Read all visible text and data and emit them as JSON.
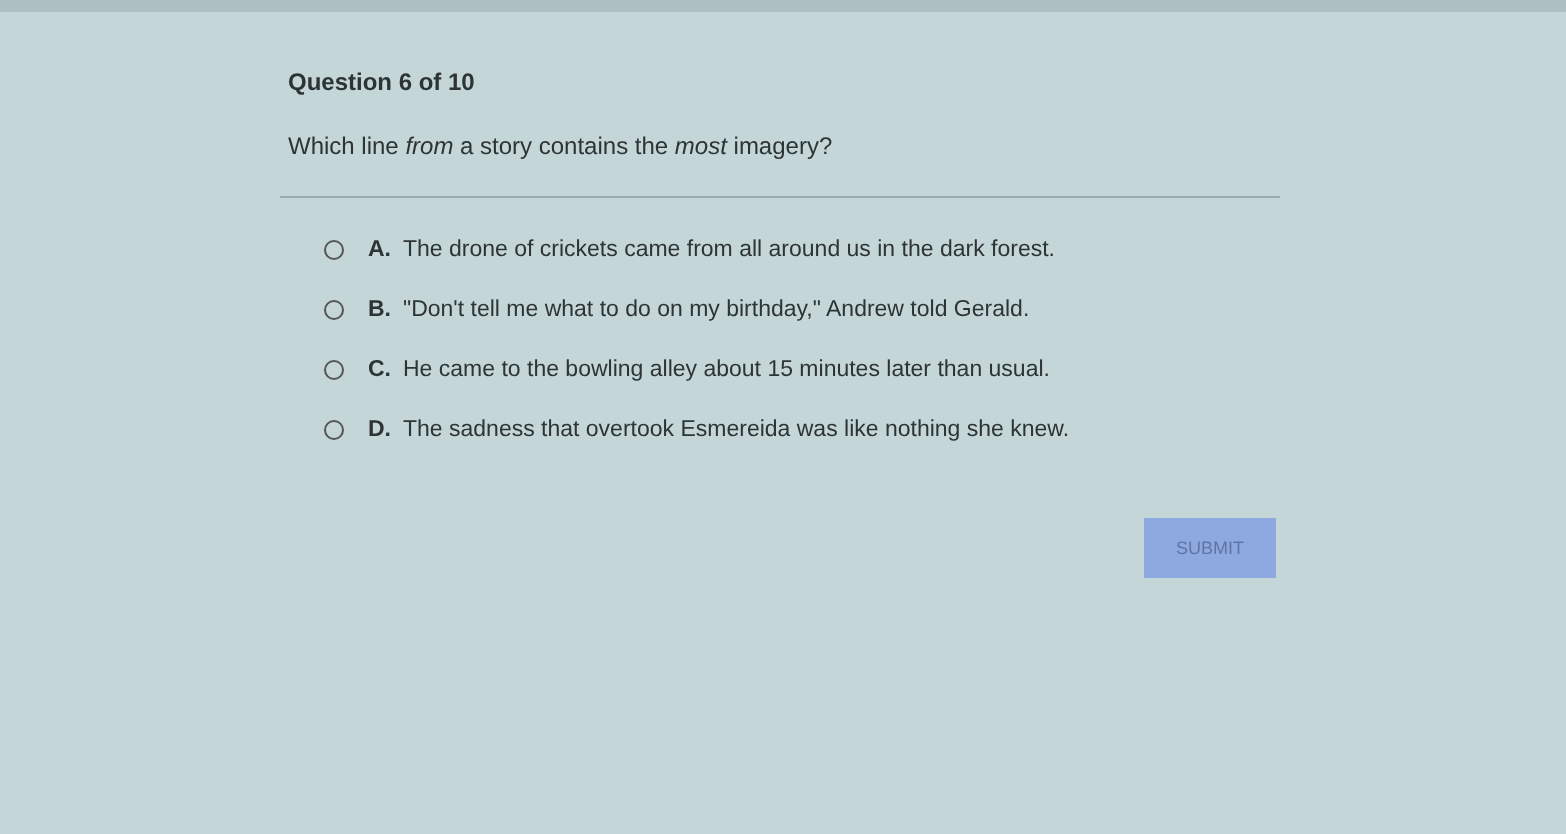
{
  "question": {
    "counter": "Question 6 of 10",
    "prompt": "Which line *from* a story contains the *most* imagery?"
  },
  "options": [
    {
      "letter": "A.",
      "text": "The drone of crickets came from all around us in the dark forest.",
      "selected": false
    },
    {
      "letter": "B.",
      "text": "\"Don't tell me what to do on my birthday,\" Andrew told Gerald.",
      "selected": false
    },
    {
      "letter": "C.",
      "text": "He came to the bowling alley about 15 minutes later than usual.",
      "selected": false
    },
    {
      "letter": "D.",
      "text": "The sadness that overtook Esmereida was like nothing she knew.",
      "selected": false
    }
  ],
  "submit": {
    "label": "SUBMIT",
    "disabled": true
  }
}
